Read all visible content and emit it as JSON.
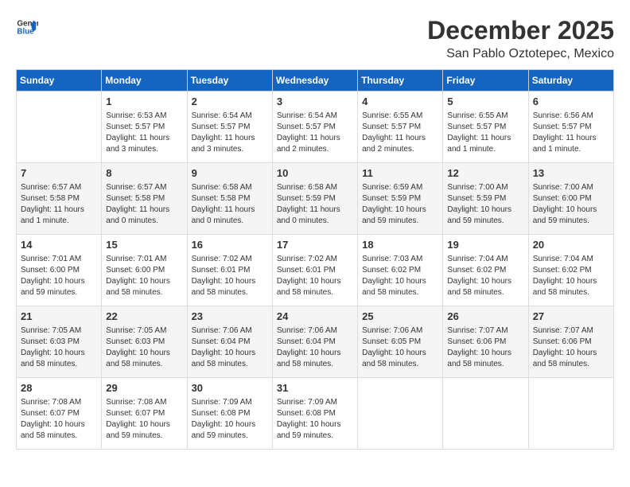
{
  "logo": {
    "line1": "General",
    "line2": "Blue"
  },
  "title": "December 2025",
  "location": "San Pablo Oztotepec, Mexico",
  "days_of_week": [
    "Sunday",
    "Monday",
    "Tuesday",
    "Wednesday",
    "Thursday",
    "Friday",
    "Saturday"
  ],
  "weeks": [
    [
      {
        "day": "",
        "info": ""
      },
      {
        "day": "1",
        "info": "Sunrise: 6:53 AM\nSunset: 5:57 PM\nDaylight: 11 hours\nand 3 minutes."
      },
      {
        "day": "2",
        "info": "Sunrise: 6:54 AM\nSunset: 5:57 PM\nDaylight: 11 hours\nand 3 minutes."
      },
      {
        "day": "3",
        "info": "Sunrise: 6:54 AM\nSunset: 5:57 PM\nDaylight: 11 hours\nand 2 minutes."
      },
      {
        "day": "4",
        "info": "Sunrise: 6:55 AM\nSunset: 5:57 PM\nDaylight: 11 hours\nand 2 minutes."
      },
      {
        "day": "5",
        "info": "Sunrise: 6:55 AM\nSunset: 5:57 PM\nDaylight: 11 hours\nand 1 minute."
      },
      {
        "day": "6",
        "info": "Sunrise: 6:56 AM\nSunset: 5:57 PM\nDaylight: 11 hours\nand 1 minute."
      }
    ],
    [
      {
        "day": "7",
        "info": "Sunrise: 6:57 AM\nSunset: 5:58 PM\nDaylight: 11 hours\nand 1 minute."
      },
      {
        "day": "8",
        "info": "Sunrise: 6:57 AM\nSunset: 5:58 PM\nDaylight: 11 hours\nand 0 minutes."
      },
      {
        "day": "9",
        "info": "Sunrise: 6:58 AM\nSunset: 5:58 PM\nDaylight: 11 hours\nand 0 minutes."
      },
      {
        "day": "10",
        "info": "Sunrise: 6:58 AM\nSunset: 5:59 PM\nDaylight: 11 hours\nand 0 minutes."
      },
      {
        "day": "11",
        "info": "Sunrise: 6:59 AM\nSunset: 5:59 PM\nDaylight: 10 hours\nand 59 minutes."
      },
      {
        "day": "12",
        "info": "Sunrise: 7:00 AM\nSunset: 5:59 PM\nDaylight: 10 hours\nand 59 minutes."
      },
      {
        "day": "13",
        "info": "Sunrise: 7:00 AM\nSunset: 6:00 PM\nDaylight: 10 hours\nand 59 minutes."
      }
    ],
    [
      {
        "day": "14",
        "info": "Sunrise: 7:01 AM\nSunset: 6:00 PM\nDaylight: 10 hours\nand 59 minutes."
      },
      {
        "day": "15",
        "info": "Sunrise: 7:01 AM\nSunset: 6:00 PM\nDaylight: 10 hours\nand 58 minutes."
      },
      {
        "day": "16",
        "info": "Sunrise: 7:02 AM\nSunset: 6:01 PM\nDaylight: 10 hours\nand 58 minutes."
      },
      {
        "day": "17",
        "info": "Sunrise: 7:02 AM\nSunset: 6:01 PM\nDaylight: 10 hours\nand 58 minutes."
      },
      {
        "day": "18",
        "info": "Sunrise: 7:03 AM\nSunset: 6:02 PM\nDaylight: 10 hours\nand 58 minutes."
      },
      {
        "day": "19",
        "info": "Sunrise: 7:04 AM\nSunset: 6:02 PM\nDaylight: 10 hours\nand 58 minutes."
      },
      {
        "day": "20",
        "info": "Sunrise: 7:04 AM\nSunset: 6:02 PM\nDaylight: 10 hours\nand 58 minutes."
      }
    ],
    [
      {
        "day": "21",
        "info": "Sunrise: 7:05 AM\nSunset: 6:03 PM\nDaylight: 10 hours\nand 58 minutes."
      },
      {
        "day": "22",
        "info": "Sunrise: 7:05 AM\nSunset: 6:03 PM\nDaylight: 10 hours\nand 58 minutes."
      },
      {
        "day": "23",
        "info": "Sunrise: 7:06 AM\nSunset: 6:04 PM\nDaylight: 10 hours\nand 58 minutes."
      },
      {
        "day": "24",
        "info": "Sunrise: 7:06 AM\nSunset: 6:04 PM\nDaylight: 10 hours\nand 58 minutes."
      },
      {
        "day": "25",
        "info": "Sunrise: 7:06 AM\nSunset: 6:05 PM\nDaylight: 10 hours\nand 58 minutes."
      },
      {
        "day": "26",
        "info": "Sunrise: 7:07 AM\nSunset: 6:06 PM\nDaylight: 10 hours\nand 58 minutes."
      },
      {
        "day": "27",
        "info": "Sunrise: 7:07 AM\nSunset: 6:06 PM\nDaylight: 10 hours\nand 58 minutes."
      }
    ],
    [
      {
        "day": "28",
        "info": "Sunrise: 7:08 AM\nSunset: 6:07 PM\nDaylight: 10 hours\nand 58 minutes."
      },
      {
        "day": "29",
        "info": "Sunrise: 7:08 AM\nSunset: 6:07 PM\nDaylight: 10 hours\nand 59 minutes."
      },
      {
        "day": "30",
        "info": "Sunrise: 7:09 AM\nSunset: 6:08 PM\nDaylight: 10 hours\nand 59 minutes."
      },
      {
        "day": "31",
        "info": "Sunrise: 7:09 AM\nSunset: 6:08 PM\nDaylight: 10 hours\nand 59 minutes."
      },
      {
        "day": "",
        "info": ""
      },
      {
        "day": "",
        "info": ""
      },
      {
        "day": "",
        "info": ""
      }
    ]
  ]
}
